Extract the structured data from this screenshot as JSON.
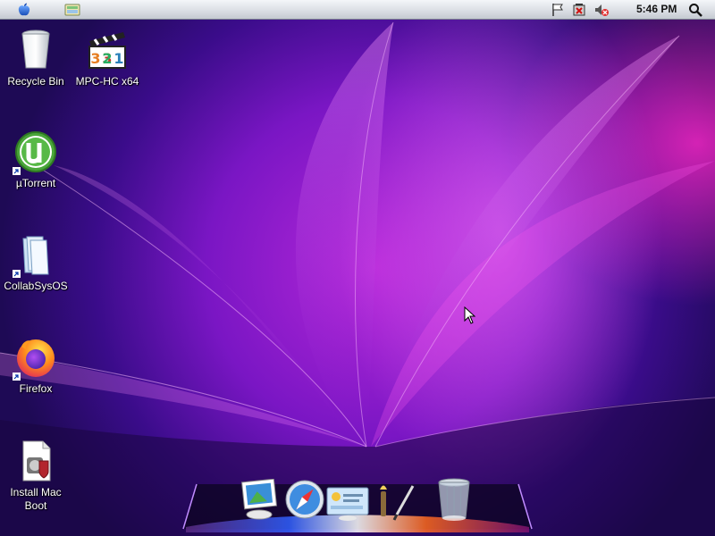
{
  "menubar": {
    "clock": "5:46 PM",
    "icons": [
      "apple-icon",
      "finder-icon",
      "flag-icon",
      "battery-icon",
      "volume-muted-icon",
      "spotlight-search-icon"
    ]
  },
  "desktop": {
    "icons": [
      {
        "name": "Recycle Bin",
        "icon": "recycle-bin-icon"
      },
      {
        "name": "MPC-HC x64",
        "icon": "mpc-hc-icon"
      },
      {
        "name": "µTorrent",
        "icon": "utorrent-icon"
      },
      {
        "name": "CollabSysOS",
        "icon": "folder-icon"
      },
      {
        "name": "Firefox",
        "icon": "firefox-icon"
      },
      {
        "name": "Install Mac Boot",
        "icon": "installer-icon"
      }
    ]
  },
  "dock": {
    "items": [
      "preview-icon",
      "safari-icon",
      "system-info-icon",
      "brush-icon",
      "trash-icon"
    ]
  },
  "colors": {
    "wallpaper_accent": "#b427d8",
    "wallpaper_highlight": "#ff28c8",
    "menubar": "#d9dde3"
  }
}
